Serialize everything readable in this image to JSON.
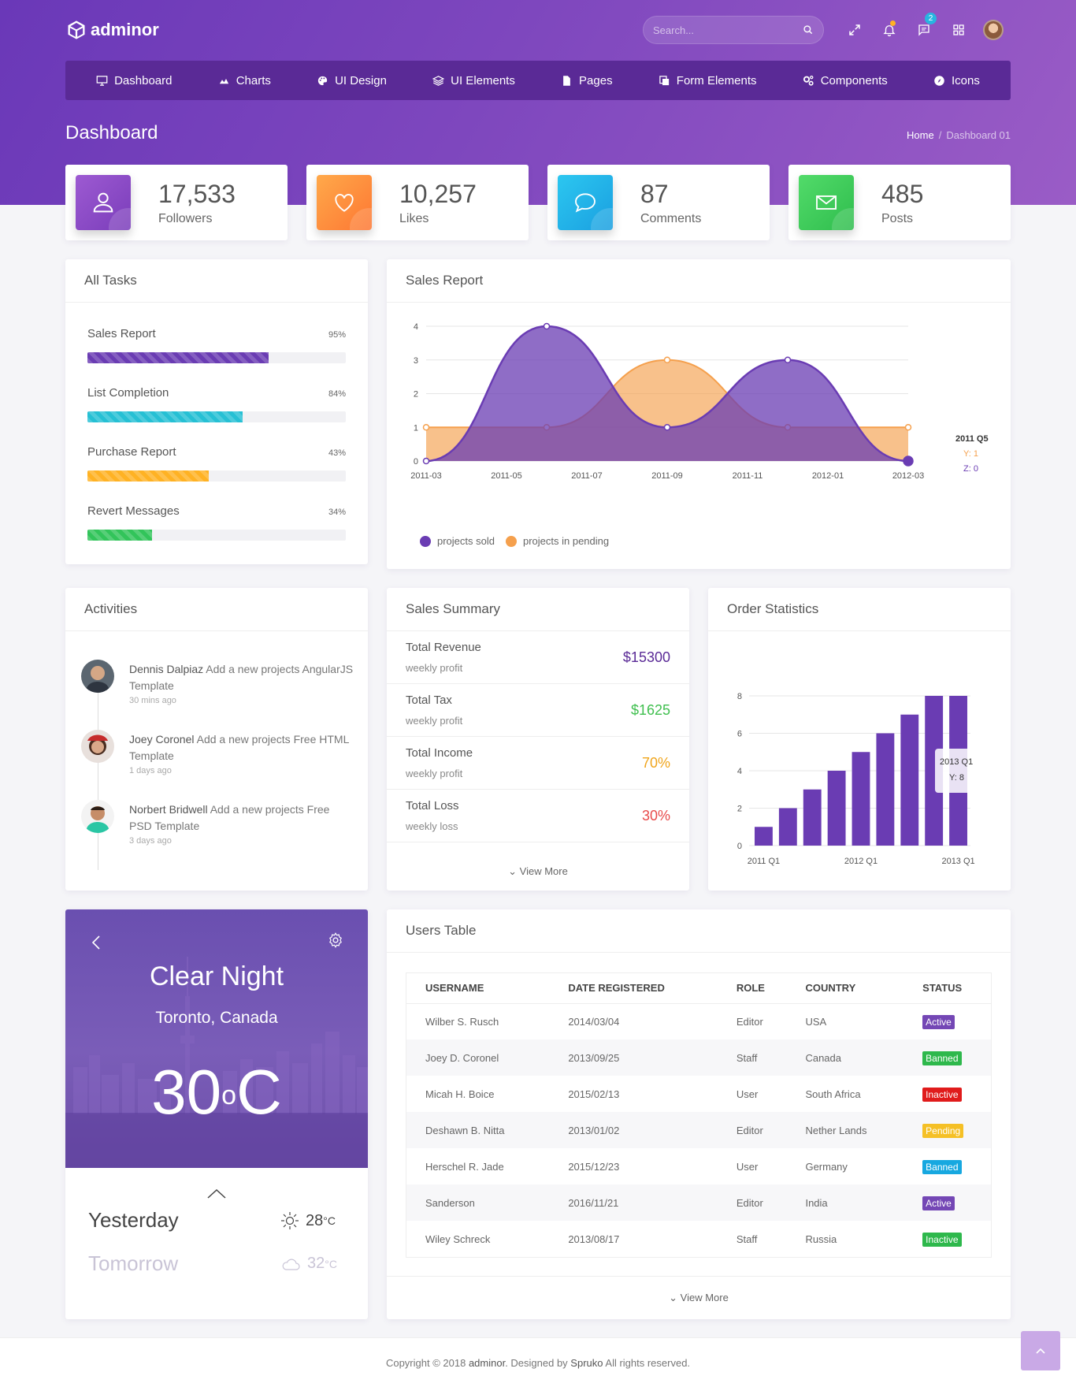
{
  "brand": {
    "name": "adminor"
  },
  "header": {
    "search_placeholder": "Search...",
    "messages_badge": "2"
  },
  "nav": [
    {
      "label": "Dashboard",
      "icon": "monitor-icon"
    },
    {
      "label": "Charts",
      "icon": "area-chart-icon"
    },
    {
      "label": "UI Design",
      "icon": "palette-icon"
    },
    {
      "label": "UI Elements",
      "icon": "layers-icon"
    },
    {
      "label": "Pages",
      "icon": "file-icon"
    },
    {
      "label": "Form Elements",
      "icon": "form-icon"
    },
    {
      "label": "Components",
      "icon": "cogs-icon"
    },
    {
      "label": "Icons",
      "icon": "compass-icon"
    }
  ],
  "page": {
    "title": "Dashboard",
    "breadcrumb_home": "Home",
    "breadcrumb_current": "Dashboard 01"
  },
  "stats": [
    {
      "value": "17,533",
      "label": "Followers",
      "icon": "user-icon",
      "color": "#8e4fc6"
    },
    {
      "value": "10,257",
      "label": "Likes",
      "icon": "heart-icon",
      "color": "#fd8d3e"
    },
    {
      "value": "87",
      "label": "Comments",
      "icon": "comment-icon",
      "color": "#1ab6ea"
    },
    {
      "value": "485",
      "label": "Posts",
      "icon": "envelope-icon",
      "color": "#3ecf5c"
    }
  ],
  "tasks": {
    "title": "All Tasks",
    "items": [
      {
        "name": "Sales Report",
        "pct": "95%",
        "fill": 0.7,
        "color": "#6a3cb3"
      },
      {
        "name": "List Completion",
        "pct": "84%",
        "fill": 0.6,
        "color": "#26c0d4"
      },
      {
        "name": "Purchase Report",
        "pct": "43%",
        "fill": 0.47,
        "color": "#ffb224"
      },
      {
        "name": "Revert Messages",
        "pct": "34%",
        "fill": 0.25,
        "color": "#32c45a"
      }
    ]
  },
  "sales_report": {
    "title": "Sales Report",
    "tooltip": {
      "title": "2011 Q5",
      "y": "Y: 1",
      "z": "Z: 0"
    }
  },
  "activities": {
    "title": "Activities",
    "items": [
      {
        "name": "Dennis Dalpiaz",
        "text": " Add a new projects AngularJS Template",
        "time": "30 mins ago"
      },
      {
        "name": "Joey Coronel",
        "text": " Add a new projects Free HTML Template",
        "time": "1 days ago"
      },
      {
        "name": "Norbert Bridwell",
        "text": " Add a new projects Free PSD Template",
        "time": "3 days ago"
      }
    ]
  },
  "sales_summary": {
    "title": "Sales Summary",
    "rows": [
      {
        "label": "Total Revenue",
        "sub": "weekly profit",
        "value": "$15300",
        "color": "#5a2a96"
      },
      {
        "label": "Total Tax",
        "sub": "weekly profit",
        "value": "$1625",
        "color": "#3fbf4e"
      },
      {
        "label": "Total Income",
        "sub": "weekly profit",
        "value": "70%",
        "color": "#f0a51c"
      },
      {
        "label": "Total Loss",
        "sub": "weekly loss",
        "value": "30%",
        "color": "#e84a4a"
      }
    ],
    "view_more": "View More"
  },
  "order_stats": {
    "title": "Order Statistics",
    "tooltip": {
      "title": "2013 Q1",
      "y": "Y: 8"
    }
  },
  "weather": {
    "condition": "Clear Night",
    "location": "Toronto, Canada",
    "temp": "30",
    "unit": "C",
    "yesterday_label": "Yesterday",
    "yesterday_temp": "28",
    "tomorrow_label": "Tomorrow",
    "tomorrow_temp": "32",
    "deg_unit": "°C"
  },
  "users_table": {
    "title": "Users Table",
    "columns": [
      "USERNAME",
      "DATE REGISTERED",
      "ROLE",
      "COUNTRY",
      "STATUS"
    ],
    "rows": [
      {
        "username": "Wilber S. Rusch",
        "date": "2014/03/04",
        "role": "Editor",
        "country": "USA",
        "status": "Active",
        "color": "#7447b5"
      },
      {
        "username": "Joey D. Coronel",
        "date": "2013/09/25",
        "role": "Staff",
        "country": "Canada",
        "status": "Banned",
        "color": "#2eb84c"
      },
      {
        "username": "Micah H. Boice",
        "date": "2015/02/13",
        "role": "User",
        "country": "South Africa",
        "status": "Inactive",
        "color": "#e01b1b"
      },
      {
        "username": "Deshawn B. Nitta",
        "date": "2013/01/02",
        "role": "Editor",
        "country": "Nether Lands",
        "status": "Pending",
        "color": "#f5c026"
      },
      {
        "username": "Herschel R. Jade",
        "date": "2015/12/23",
        "role": "User",
        "country": "Germany",
        "status": "Banned",
        "color": "#17a8e0"
      },
      {
        "username": "Sanderson",
        "date": "2016/11/21",
        "role": "Editor",
        "country": "India",
        "status": "Active",
        "color": "#7447b5"
      },
      {
        "username": "Wiley Schreck",
        "date": "2013/08/17",
        "role": "Staff",
        "country": "Russia",
        "status": "Inactive",
        "color": "#2eb84c"
      }
    ],
    "view_more": "View More"
  },
  "footer": {
    "prefix": "Copyright © 2018 ",
    "brand": "adminor",
    "mid": ". Designed by ",
    "author": "Spruko",
    "suffix": " All rights reserved."
  },
  "chart_data": [
    {
      "type": "area",
      "x": [
        "2011-03",
        "2011-04",
        "2011-05",
        "2011-06",
        "2011-07",
        "2011-08",
        "2011-09",
        "2011-10",
        "2011-11",
        "2011-12",
        "2012-01",
        "2012-02",
        "2012-03"
      ],
      "x_ticks": [
        "2011-03",
        "2011-05",
        "2011-07",
        "2011-09",
        "2011-11",
        "2012-01",
        "2012-03"
      ],
      "series": [
        {
          "name": "projects sold",
          "values": [
            0,
            null,
            null,
            4,
            null,
            null,
            1,
            null,
            null,
            3,
            null,
            null,
            0
          ],
          "color": "#6a3cb3"
        },
        {
          "name": "projects in pending",
          "values": [
            1,
            null,
            null,
            1,
            null,
            null,
            3,
            null,
            null,
            1,
            null,
            null,
            1
          ],
          "color": "#f5a04d"
        }
      ],
      "ylim": [
        0,
        4
      ],
      "yticks": [
        0,
        1,
        2,
        3,
        4
      ],
      "grid": true,
      "legend": "bottom-left"
    },
    {
      "type": "bar",
      "categories": [
        "2011 Q1",
        "2011 Q2",
        "2011 Q3",
        "2011 Q4",
        "2012 Q1",
        "2012 Q2",
        "2012 Q3",
        "2012 Q4",
        "2013 Q1"
      ],
      "x_ticks": [
        "2011 Q1",
        "2012 Q1",
        "2013 Q1"
      ],
      "values": [
        1,
        2,
        3,
        4,
        5,
        6,
        7,
        8,
        8
      ],
      "ylim": [
        0,
        8
      ],
      "yticks": [
        0,
        2,
        4,
        6,
        8
      ],
      "grid": true,
      "color": "#6a3cb3"
    }
  ]
}
